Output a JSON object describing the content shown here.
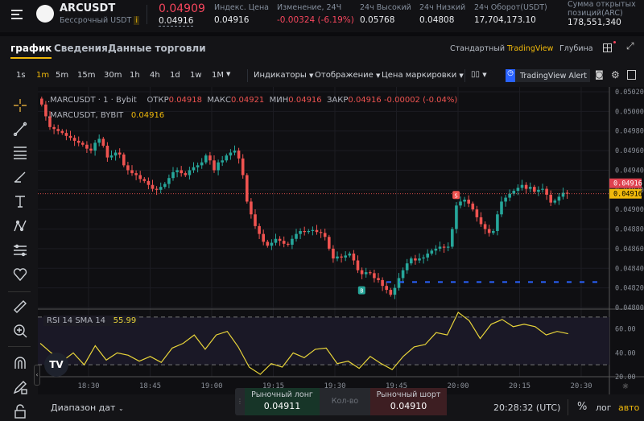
{
  "header": {
    "symbol": "ARCUSDT",
    "subtitle": "Бессрочный USDT",
    "info_icon": "i",
    "last_price": "0.04909",
    "mark_price": "0.04916",
    "stats": [
      {
        "label": "Индекс. Цена",
        "value": "0.04916",
        "color": "#eaecef"
      },
      {
        "label": "Изменение, 24Ч",
        "value": "-0.00324 (-6.19%)",
        "color": "#f6465d"
      },
      {
        "label": "24ч Высокий",
        "value": "0.05768",
        "color": "#eaecef"
      },
      {
        "label": "24ч Низкий",
        "value": "0.04808",
        "color": "#eaecef"
      },
      {
        "label": "24ч Оборот(USDT)",
        "value": "17,704,173.10",
        "color": "#eaecef"
      }
    ],
    "oi_label_1": "Сумма открытых",
    "oi_label_2": "позиций(ARC)",
    "oi_value": "178,551,340"
  },
  "tabs": [
    "график",
    "Сведения",
    "Данные торговли"
  ],
  "active_tab": 0,
  "view_modes": [
    "Стандартный",
    "TradingView",
    "Глубина"
  ],
  "active_view": 1,
  "toolbar": {
    "intervals": [
      "1s",
      "1m",
      "5m",
      "15m",
      "30m",
      "1h",
      "4h",
      "1d",
      "1w",
      "1M"
    ],
    "active_interval": "1m",
    "indicators": "Индикаторы",
    "display": "Отображение",
    "mark_price": "Цена маркировки",
    "alert": "TradingView Alert"
  },
  "legend": {
    "line1_symbol": ".MARCUSDT · 1 · Bybit",
    "o_label": "ОТКР",
    "o": "0.04918",
    "h_label": "МАКС",
    "h": "0.04921",
    "l_label": "МИН",
    "l": "0.04916",
    "c_label": "ЗАКР",
    "c": "0.04916",
    "chg": "-0.00002 (-0.04%)",
    "line2_symbol": ".MARCUSDT, BYBIT",
    "line2_value": "0.04916"
  },
  "colors": {
    "up": "#26a69a",
    "down": "#ef5350",
    "accent": "#f0b90b",
    "rsi": "#e8d43a",
    "blue": "#2962ff"
  },
  "chart_data": {
    "type": "candlestick",
    "interval": "1m",
    "closes": [
      0.05007,
      0.04995,
      0.04984,
      0.04982,
      0.0498,
      0.04978,
      0.04975,
      0.04973,
      0.0497,
      0.04968,
      0.04966,
      0.04962,
      0.0496,
      0.04968,
      0.04972,
      0.04965,
      0.04953,
      0.04955,
      0.04958,
      0.04956,
      0.04945,
      0.0494,
      0.04937,
      0.04935,
      0.04931,
      0.04929,
      0.04925,
      0.04921,
      0.0492,
      0.04923,
      0.04926,
      0.04932,
      0.04938,
      0.0494,
      0.04937,
      0.04935,
      0.0494,
      0.04943,
      0.04945,
      0.04948,
      0.04955,
      0.0495,
      0.0494,
      0.04948,
      0.0495,
      0.04955,
      0.04958,
      0.0496,
      0.04952,
      0.04935,
      0.04908,
      0.04895,
      0.04883,
      0.04875,
      0.04867,
      0.04863,
      0.04866,
      0.0487,
      0.04868,
      0.04865,
      0.04864,
      0.0487,
      0.04875,
      0.04878,
      0.04877,
      0.04878,
      0.04879,
      0.04877,
      0.04876,
      0.04872,
      0.0486,
      0.0485,
      0.04852,
      0.04851,
      0.04853,
      0.04855,
      0.04848,
      0.04838,
      0.04834,
      0.04836,
      0.04835,
      0.0483,
      0.04828,
      0.04822,
      0.04818,
      0.04813,
      0.0482,
      0.0483,
      0.04838,
      0.04845,
      0.0485,
      0.04848,
      0.0485,
      0.04851,
      0.04855,
      0.04858,
      0.0486,
      0.04862,
      0.04861,
      0.04862,
      0.0488,
      0.04904,
      0.04908,
      0.0491,
      0.04906,
      0.049,
      0.04892,
      0.04885,
      0.0488,
      0.04876,
      0.04878,
      0.04895,
      0.04908,
      0.04912,
      0.04916,
      0.04919,
      0.04922,
      0.04925,
      0.04921,
      0.04923,
      0.04918,
      0.0492,
      0.04921,
      0.04915,
      0.04907,
      0.04909,
      0.04913,
      0.04917,
      0.04916
    ],
    "ylim": [
      0.048,
      0.0502
    ],
    "price_ticks": [
      "0.05020",
      "0.05000",
      "0.04980",
      "0.04960",
      "0.04940",
      "0.04920",
      "0.04900",
      "0.04880",
      "0.04860",
      "0.04840",
      "0.04820",
      "0.04800"
    ],
    "time_ticks": [
      "18:30",
      "18:45",
      "19:00",
      "19:15",
      "19:30",
      "19:45",
      "20:00",
      "20:15",
      "20:30"
    ],
    "last_price_label": "0.04916",
    "mark_price_label": "0.04916",
    "horizontal_line": 0.04826,
    "markers": [
      {
        "text": "B",
        "index": 78,
        "type": "buy"
      },
      {
        "text": "S",
        "index": 101,
        "type": "sell"
      }
    ],
    "rsi": {
      "label": "RSI 14 SMA 14",
      "value": "55.99",
      "ylim": [
        20,
        76
      ],
      "bands": [
        70,
        30
      ],
      "ticks": [
        "60.00",
        "40.00",
        "20.00"
      ],
      "values": [
        48,
        40,
        33,
        40,
        30,
        46,
        34,
        40,
        38,
        33,
        37,
        32,
        44,
        48,
        55,
        43,
        55,
        58,
        45,
        28,
        22,
        31,
        28,
        40,
        36,
        43,
        44,
        31,
        33,
        27,
        37,
        31,
        26,
        37,
        45,
        47,
        57,
        55,
        74,
        67,
        52,
        64,
        68,
        62,
        64,
        62,
        55,
        58,
        56
      ]
    }
  },
  "bottom": {
    "date_range": "Диапазон дат",
    "long_label": "Рыночный лонг",
    "long_price": "0.04911",
    "qty_label": "Кол-во",
    "short_label": "Рыночный шорт",
    "short_price": "0.04910",
    "clock": "20:28:32 (UTC)",
    "percent": "%",
    "log": "лог",
    "auto": "авто"
  }
}
